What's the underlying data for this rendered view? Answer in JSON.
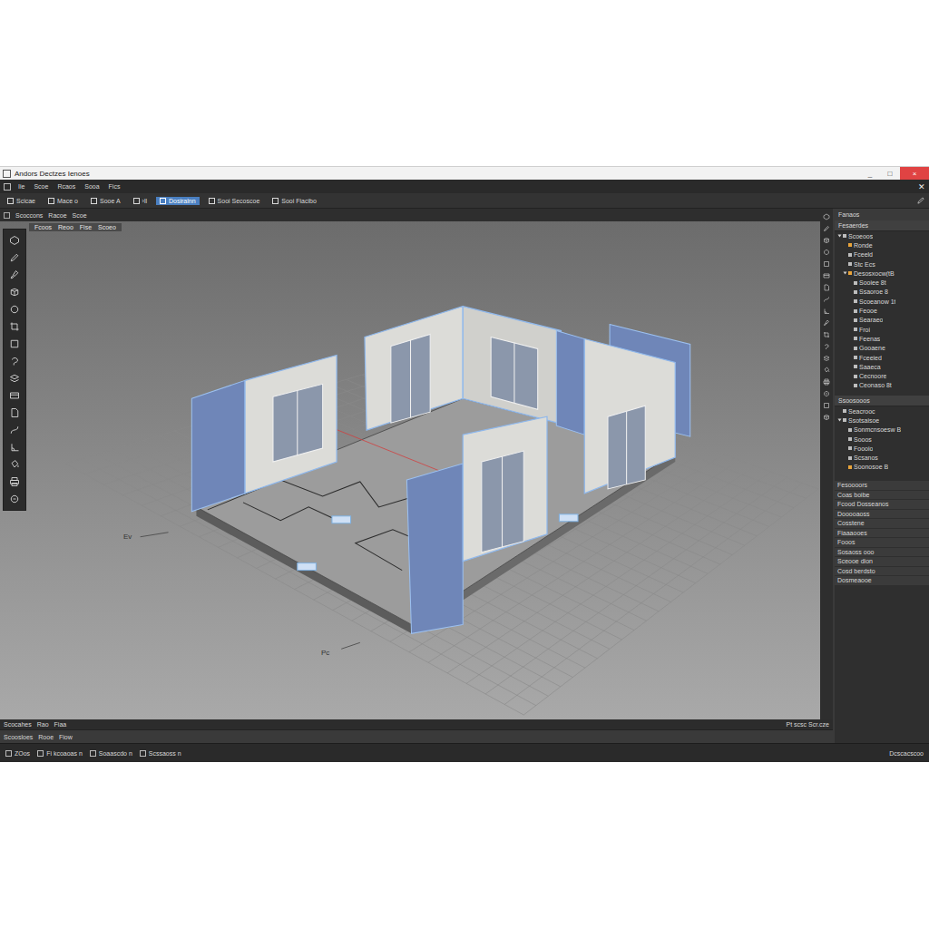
{
  "window": {
    "title": "Andors Dectzes Ienoes",
    "controls": [
      "_",
      "□",
      "×"
    ]
  },
  "menu": [
    "Iie",
    "Scoe",
    "Rcaos",
    "Sooa",
    "Fics"
  ],
  "menu_close": "✕",
  "toolbar": [
    {
      "label": "Scicae",
      "selected": false
    },
    {
      "label": "Mace o",
      "selected": false
    },
    {
      "label": "Sooe A",
      "selected": false
    },
    {
      "label": "›ll",
      "selected": false
    },
    {
      "label": "Dosiralnn",
      "selected": true
    },
    {
      "label": "Sooi Secoscoe",
      "selected": false
    },
    {
      "label": "Sooi Fiacibo",
      "selected": false
    }
  ],
  "viewport": {
    "tabs": [
      "Scoccons",
      "Racoe",
      "Scoe"
    ],
    "subtabs": [
      "Fcoos",
      "Reoo",
      "Fise",
      "Scoeo"
    ],
    "labels": [
      "Ev",
      "Pc"
    ]
  },
  "panel": {
    "title": "Fanaos",
    "header": "Fesaerdes",
    "tree": [
      {
        "label": "Scoeoos",
        "depth": 0,
        "kind": "folder",
        "expanded": true,
        "color": "#bdbdbd"
      },
      {
        "label": "Ronde",
        "depth": 1,
        "kind": "leaf",
        "expanded": false,
        "color": "#e8a33a"
      },
      {
        "label": "Fceeld",
        "depth": 1,
        "kind": "leaf",
        "expanded": false,
        "color": "#bdbdbd"
      },
      {
        "label": "Stc Ecs",
        "depth": 1,
        "kind": "leaf",
        "expanded": false,
        "color": "#bdbdbd"
      },
      {
        "label": "Desosxocw(tB",
        "depth": 1,
        "kind": "folder",
        "expanded": true,
        "color": "#e8a33a"
      },
      {
        "label": "Sooiee 8t",
        "depth": 2,
        "kind": "leaf",
        "expanded": false,
        "color": "#bdbdbd"
      },
      {
        "label": "Ssaoroe 8",
        "depth": 2,
        "kind": "leaf",
        "expanded": false,
        "color": "#bdbdbd"
      },
      {
        "label": "Scoeanow 1t",
        "depth": 2,
        "kind": "leaf",
        "expanded": false,
        "color": "#bdbdbd"
      },
      {
        "label": "Feooe",
        "depth": 2,
        "kind": "leaf",
        "expanded": false,
        "color": "#bdbdbd"
      },
      {
        "label": "Searaeo",
        "depth": 2,
        "kind": "leaf",
        "expanded": false,
        "color": "#bdbdbd"
      },
      {
        "label": "Froi",
        "depth": 2,
        "kind": "leaf",
        "expanded": false,
        "color": "#bdbdbd"
      },
      {
        "label": "Feenas",
        "depth": 2,
        "kind": "leaf",
        "expanded": false,
        "color": "#bdbdbd"
      },
      {
        "label": "Gooaene",
        "depth": 2,
        "kind": "leaf",
        "expanded": false,
        "color": "#bdbdbd"
      },
      {
        "label": "Fceeied",
        "depth": 2,
        "kind": "leaf",
        "expanded": false,
        "color": "#bdbdbd"
      },
      {
        "label": "Saaeca",
        "depth": 2,
        "kind": "leaf",
        "expanded": false,
        "color": "#bdbdbd"
      },
      {
        "label": "Cecnoore",
        "depth": 2,
        "kind": "leaf",
        "expanded": false,
        "color": "#bdbdbd"
      },
      {
        "label": "Ceonaso 8t",
        "depth": 2,
        "kind": "leaf",
        "expanded": false,
        "color": "#bdbdbd"
      }
    ],
    "section": "Ssoosooos",
    "tree2": [
      {
        "label": "Seacrooc",
        "depth": 0,
        "kind": "leaf",
        "expanded": false,
        "color": "#bdbdbd"
      },
      {
        "label": "Ssotsaisoe",
        "depth": 0,
        "kind": "folder",
        "expanded": true,
        "color": "#bdbdbd"
      },
      {
        "label": "Sonmcnsoesw B",
        "depth": 1,
        "kind": "leaf",
        "expanded": false,
        "color": "#bdbdbd"
      },
      {
        "label": "Sooos",
        "depth": 1,
        "kind": "leaf",
        "expanded": false,
        "color": "#bdbdbd"
      },
      {
        "label": "Foooio",
        "depth": 1,
        "kind": "leaf",
        "expanded": false,
        "color": "#bdbdbd"
      },
      {
        "label": "Scsanos",
        "depth": 1,
        "kind": "leaf",
        "expanded": false,
        "color": "#bdbdbd"
      },
      {
        "label": "Soonosoe B",
        "depth": 1,
        "kind": "leaf",
        "expanded": false,
        "color": "#e8a33a"
      }
    ],
    "properties": [
      "Fesoooors",
      "Coas boibe",
      "Fcood Dosseanos",
      "Dooooaoss",
      "Cosstene",
      "Fiaaaooes",
      "Fooos",
      "Sosaoss ooo",
      "Sceooe dion",
      "Cosd berdsto",
      "Dosmeaooe"
    ]
  },
  "bottom_bar": {
    "left": [
      "Scocahes",
      "Rao",
      "Fiaa"
    ],
    "right": "Pt scsc Scr.cze"
  },
  "bottom_bar2": [
    "Scoosloes",
    "Rooe",
    "Fiow"
  ],
  "status_bar": {
    "items": [
      "ZOos",
      "Fi kcoaoas n",
      "Soaascdo n",
      "Scssaoss n"
    ],
    "right": "Dcscacscoo"
  }
}
